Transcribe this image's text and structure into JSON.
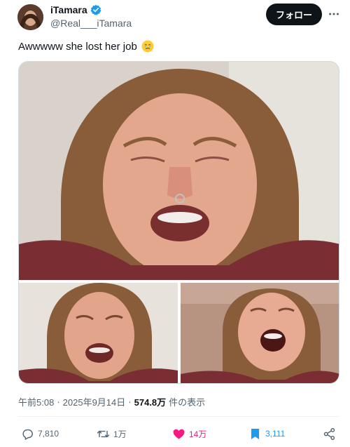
{
  "author": {
    "display_name": "iTamara",
    "handle": "@Real___iTamara",
    "verified": true
  },
  "header": {
    "follow_label": "フォロー",
    "more_icon": "more-horizontal-icon"
  },
  "tweet": {
    "text": "Awwwww she lost her job",
    "emoji": "face-holding-back-tears-emoji"
  },
  "media": {
    "count": 3,
    "description_icons": [
      "photo",
      "photo",
      "photo"
    ]
  },
  "meta": {
    "time": "午前5:08",
    "sep1": "·",
    "date": "2025年9月14日",
    "sep2": "·",
    "views_count": "574.8万",
    "views_label": "件の表示"
  },
  "actions": {
    "replies": "7,810",
    "retweets": "1万",
    "likes": "14万",
    "bookmarks": "3,111"
  },
  "colors": {
    "text": "#0f1419",
    "muted": "#536471",
    "like": "#f91880",
    "bookmark": "#1d9bf0",
    "verified": "#1d9bf0"
  }
}
